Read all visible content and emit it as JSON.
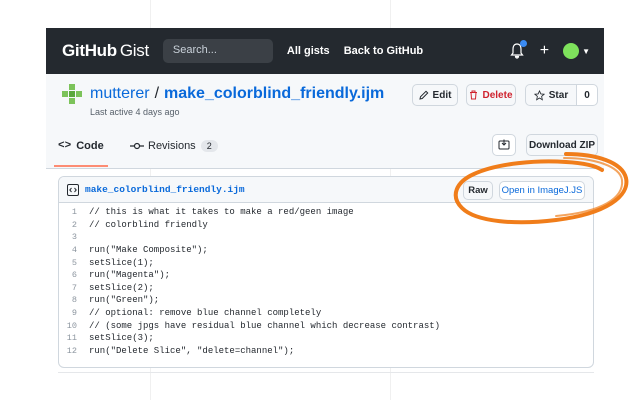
{
  "header": {
    "logo_main": "GitHub",
    "logo_sub": "Gist",
    "search_placeholder": "Search...",
    "nav": [
      "All gists",
      "Back to GitHub"
    ],
    "plus_symbol": "+",
    "icons": [
      "bell-icon",
      "plus-icon",
      "user-avatar",
      "caret-down-icon"
    ]
  },
  "gist": {
    "owner": "mutterer",
    "separator": "/",
    "name": "make_colorblind_friendly.ijm",
    "last_active": "Last active 4 days ago",
    "actions": {
      "edit": "Edit",
      "delete": "Delete",
      "star": "Star",
      "star_count": "0"
    },
    "tabs": {
      "code": "Code",
      "revisions": "Revisions",
      "revisions_count": "2"
    },
    "download_zip": "Download ZIP"
  },
  "file": {
    "name": "make_colorblind_friendly.ijm",
    "raw": "Raw",
    "open_in": "Open in ImageJ.JS",
    "lines": [
      {
        "n": "1",
        "text": "// this is what it takes to make a red/geen image"
      },
      {
        "n": "2",
        "text": "// colorblind friendly"
      },
      {
        "n": "3",
        "text": ""
      },
      {
        "n": "4",
        "text": "run(\"Make Composite\");"
      },
      {
        "n": "5",
        "text": "setSlice(1);"
      },
      {
        "n": "6",
        "text": "run(\"Magenta\");"
      },
      {
        "n": "7",
        "text": "setSlice(2);"
      },
      {
        "n": "8",
        "text": "run(\"Green\");"
      },
      {
        "n": "9",
        "text": "// optional: remove blue channel completely"
      },
      {
        "n": "10",
        "text": "// (some jpgs have residual blue channel which decrease contrast)"
      },
      {
        "n": "11",
        "text": "setSlice(3);"
      },
      {
        "n": "12",
        "text": "run(\"Delete Slice\", \"delete=channel\");"
      }
    ]
  },
  "colors": {
    "header_bg": "#24292f",
    "link_blue": "#0969da",
    "delete_red": "#cf222e",
    "annotation_orange": "#f07d1a",
    "tab_underline": "#fd8c73"
  }
}
